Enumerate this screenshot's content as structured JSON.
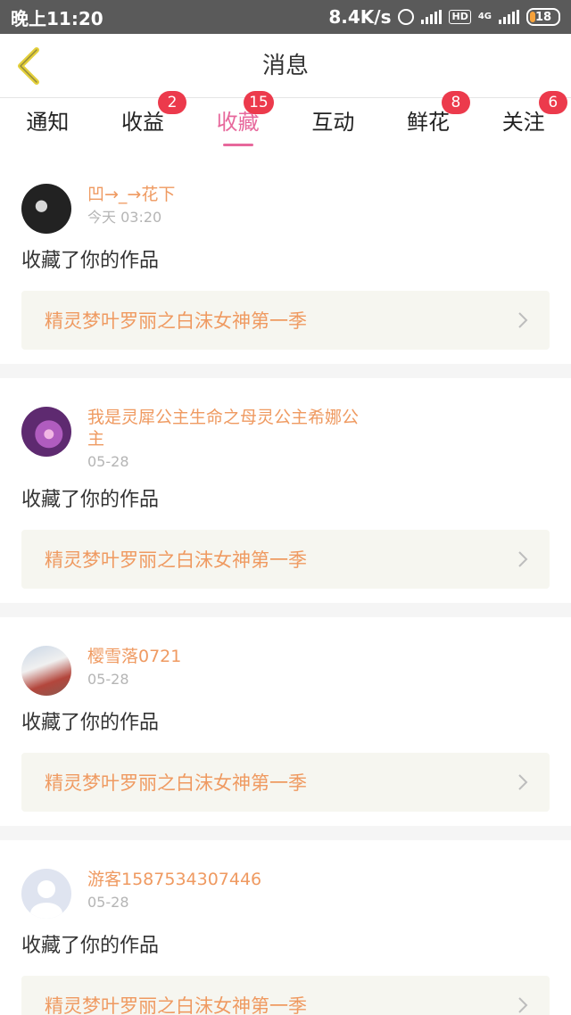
{
  "status_bar": {
    "time": "晚上11:20",
    "speed": "8.4K/s",
    "hd": "HD",
    "network": "4G",
    "battery": "18"
  },
  "header": {
    "title": "消息"
  },
  "tabs": [
    {
      "label": "通知",
      "badge": ""
    },
    {
      "label": "收益",
      "badge": "2"
    },
    {
      "label": "收藏",
      "badge": "15"
    },
    {
      "label": "互动",
      "badge": ""
    },
    {
      "label": "鲜花",
      "badge": "8"
    },
    {
      "label": "关注",
      "badge": "6"
    }
  ],
  "feed": [
    {
      "username": "凹→_→花下",
      "time": "今天 03:20",
      "action": "收藏了你的作品",
      "work": "精灵梦叶罗丽之白沫女神第一季"
    },
    {
      "username": "我是灵犀公主生命之母灵公主希娜公主",
      "time": "05-28",
      "action": "收藏了你的作品",
      "work": "精灵梦叶罗丽之白沫女神第一季"
    },
    {
      "username": "樱雪落0721",
      "time": "05-28",
      "action": "收藏了你的作品",
      "work": "精灵梦叶罗丽之白沫女神第一季"
    },
    {
      "username": "游客1587534307446",
      "time": "05-28",
      "action": "收藏了你的作品",
      "work": "精灵梦叶罗丽之白沫女神第一季"
    }
  ],
  "colors": {
    "accent": "#e7689c",
    "username": "#ef9a61",
    "badge": "#ec3a4c"
  }
}
